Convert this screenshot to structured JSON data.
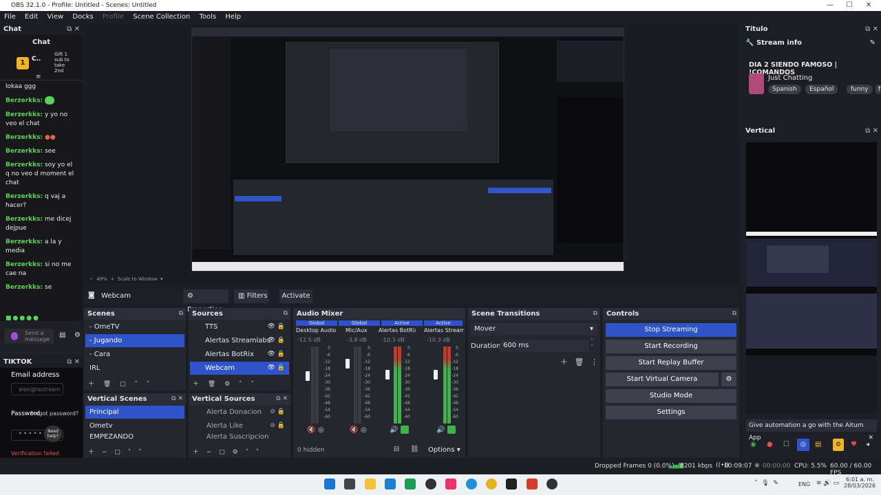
{
  "window": {
    "title": "OBS 32.1.0 - Profile: Untitled - Scenes: Untitled"
  },
  "menu": [
    "File",
    "Edit",
    "View",
    "Docks",
    "Profile",
    "Scene Collection",
    "Tools",
    "Help"
  ],
  "chat": {
    "dock_title": "Chat",
    "header": "Chat",
    "gift_user": "C..",
    "gift_badge": "1",
    "gift_text": "Gift 1 sub to take 2nd",
    "messages": [
      {
        "user": "",
        "text": "lokaa ggg"
      },
      {
        "user": "Berzerkks:",
        "text": ""
      },
      {
        "user": "Berzerkks:",
        "text": "y yo no veo el chat"
      },
      {
        "user": "Berzerkks:",
        "text": ""
      },
      {
        "user": "Berzerkks:",
        "text": "see"
      },
      {
        "user": "Berzerkks:",
        "text": "soy yo el q no veo d moment el chat"
      },
      {
        "user": "Berzerkks:",
        "text": "q vaj a hacer?"
      },
      {
        "user": "Berzerkks:",
        "text": "me dicej dejpue"
      },
      {
        "user": "Berzerkks:",
        "text": "a la y media"
      },
      {
        "user": "Berzerkks:",
        "text": "si no me cae na"
      },
      {
        "user": "Berzerkks:",
        "text": "se"
      }
    ],
    "send_placeholder": "Send a message"
  },
  "tiktok": {
    "dock_title": "TIKTOK",
    "email_label": "Email address",
    "email_placeholder": "alex@restream",
    "password_label": "Password",
    "forgot": "Forgot password?",
    "need_help": "Need help?",
    "error": "Verification failed"
  },
  "titulo": {
    "dock_title": "Titulo",
    "stream_info": "Stream info",
    "stream_title": "DIA 2 SIENDO FAMOSO | !COMANDOS",
    "category": "Just Chatting",
    "tags": [
      "Spanish",
      "Español",
      "funny",
      "f"
    ]
  },
  "vertical": {
    "dock_title": "Vertical",
    "banner": "Give automation a go with the Aitum App"
  },
  "source_toolbar": {
    "source": "Webcam",
    "properties": "Properties",
    "filters": "Filters",
    "activate": "Activate"
  },
  "preview_toolbar": {
    "zoom": "49%",
    "scale": "Scale to Window"
  },
  "scenes": {
    "title": "Scenes",
    "items": [
      "- OmeTV",
      "- Jugando",
      "- Cara",
      "IRL"
    ],
    "selected": 1
  },
  "sources": {
    "title": "Sources",
    "items": [
      "TTS",
      "Alertas Streamlabs",
      "Alertas BotRix",
      "Webcam"
    ],
    "selected": 3
  },
  "vertical_scenes": {
    "title": "Vertical Scenes",
    "items": [
      "Principal",
      "Ometv",
      "EMPEZANDO"
    ],
    "selected": 0
  },
  "vertical_sources": {
    "title": "Vertical Sources",
    "items": [
      "Alerta Donacion",
      "Alerta Like",
      "Alerta Suscripcion"
    ]
  },
  "audio_mixer": {
    "title": "Audio Mixer",
    "channels": [
      {
        "tag": "Global",
        "name": "Desktop Audio",
        "db": "-12.5 dB"
      },
      {
        "tag": "Global",
        "name": "Mic/Aux",
        "db": "-3.8 dB"
      },
      {
        "tag": "Active",
        "name": "Alertas BotRix",
        "db": "-10.3 dB"
      },
      {
        "tag": "Active",
        "name": "Alertas Streamlat",
        "db": "-10.3 dB"
      }
    ],
    "scale": [
      "0",
      "-6",
      "-12",
      "-18",
      "-24",
      "-30",
      "-36",
      "-42",
      "-48",
      "-54",
      "-60"
    ],
    "hidden": "0 hidden",
    "options": "Options"
  },
  "transitions": {
    "title": "Scene Transitions",
    "selected": "Mover",
    "duration_label": "Duration",
    "duration": "600 ms"
  },
  "controls": {
    "title": "Controls",
    "buttons": [
      "Stop Streaming",
      "Start Recording",
      "Start Replay Buffer",
      "Start Virtual Camera",
      "Studio Mode",
      "Settings"
    ]
  },
  "statusbar": {
    "dropped": "Dropped Frames 0 (0.0%)",
    "bitrate": "8201 kbps",
    "stream_time": "00:09:07",
    "rec_time": "00:00:00",
    "cpu": "CPU: 5.5%",
    "fps": "60.00 / 60.00 FPS"
  },
  "taskbar": {
    "lang": "ENG",
    "time": "6:01 a. m.",
    "date": "28/03/2026"
  },
  "colors": {
    "accent": "#2f53c9",
    "live_green": "#3fb04a",
    "error": "#e05050"
  }
}
